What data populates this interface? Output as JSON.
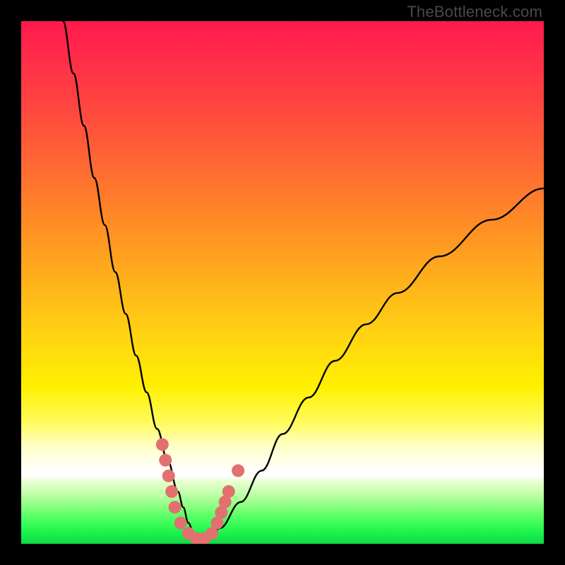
{
  "watermark": "TheBottleneck.com",
  "chart_data": {
    "type": "line",
    "title": "",
    "xlabel": "",
    "ylabel": "",
    "xlim": [
      0,
      100
    ],
    "ylim": [
      0,
      100
    ],
    "series": [
      {
        "name": "bottleneck-curve",
        "x": [
          8,
          10,
          12,
          14,
          16,
          18,
          20,
          22,
          24,
          26,
          28,
          30,
          31,
          32,
          33,
          34,
          36,
          38,
          42,
          46,
          50,
          55,
          60,
          66,
          72,
          80,
          90,
          100
        ],
        "values": [
          100,
          90,
          80,
          70,
          61,
          52,
          44,
          36,
          29,
          22,
          16,
          10,
          7,
          4,
          2,
          1,
          1,
          3,
          8,
          14,
          21,
          28,
          35,
          42,
          48,
          55,
          62,
          68
        ]
      }
    ],
    "markers": {
      "name": "highlighted-points",
      "color": "#e26f6f",
      "points": [
        {
          "x": 27.0,
          "y": 19
        },
        {
          "x": 27.6,
          "y": 16
        },
        {
          "x": 28.2,
          "y": 13
        },
        {
          "x": 28.8,
          "y": 10
        },
        {
          "x": 29.4,
          "y": 7
        },
        {
          "x": 30.5,
          "y": 4
        },
        {
          "x": 32.0,
          "y": 2
        },
        {
          "x": 33.5,
          "y": 1
        },
        {
          "x": 35.0,
          "y": 1
        },
        {
          "x": 36.5,
          "y": 2
        },
        {
          "x": 37.5,
          "y": 4
        },
        {
          "x": 38.3,
          "y": 6
        },
        {
          "x": 39.0,
          "y": 8
        },
        {
          "x": 39.7,
          "y": 10
        },
        {
          "x": 41.5,
          "y": 14
        }
      ]
    },
    "colors": {
      "curve": "#000000",
      "marker": "#e2706f",
      "frame": "#000000"
    }
  }
}
